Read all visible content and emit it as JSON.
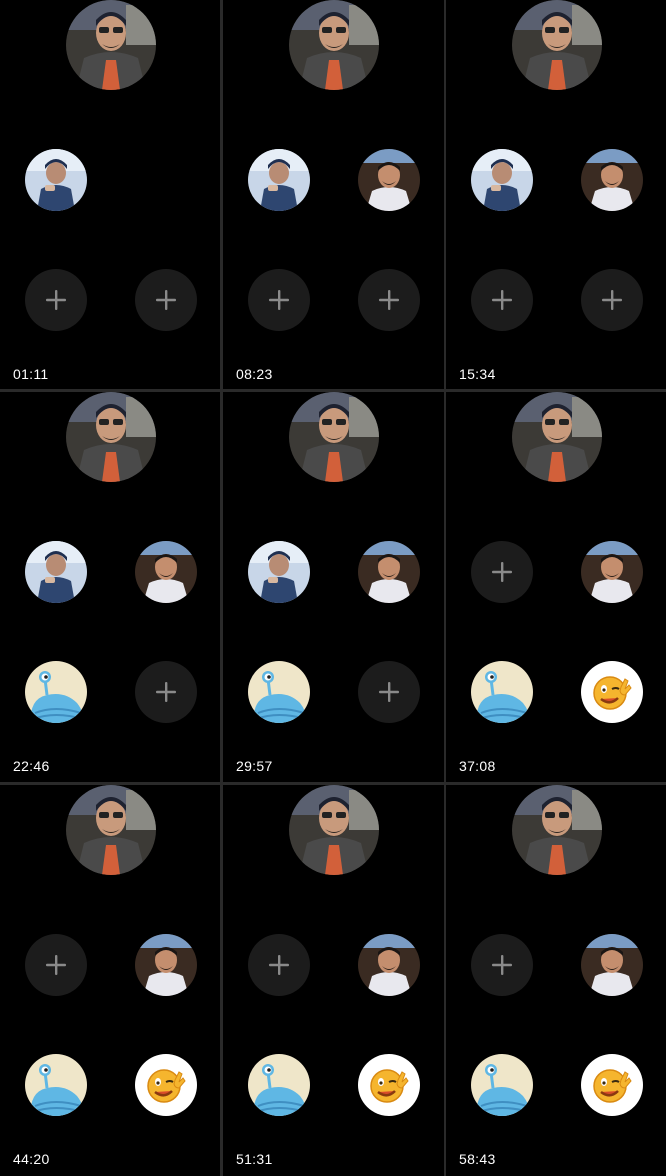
{
  "app": {
    "screen": "video call grid recording"
  },
  "panels": [
    {
      "time": "01:11",
      "slots": [
        "user1",
        "",
        "add",
        "add"
      ]
    },
    {
      "time": "08:23",
      "slots": [
        "user1",
        "user2",
        "add",
        "add"
      ]
    },
    {
      "time": "15:34",
      "slots": [
        "user1",
        "user2",
        "add",
        "add"
      ]
    },
    {
      "time": "22:46",
      "slots": [
        "user1",
        "user2",
        "user3",
        "add"
      ]
    },
    {
      "time": "29:57",
      "slots": [
        "user1",
        "user2",
        "user3",
        "add"
      ]
    },
    {
      "time": "37:08",
      "slots": [
        "add",
        "user2",
        "user3",
        "user4"
      ]
    },
    {
      "time": "44:20",
      "slots": [
        "add",
        "user2",
        "user3",
        "user4"
      ]
    },
    {
      "time": "51:31",
      "slots": [
        "add",
        "user2",
        "user3",
        "user4"
      ]
    },
    {
      "time": "58:43",
      "slots": [
        "add",
        "user2",
        "user3",
        "user4"
      ]
    }
  ],
  "icons": {
    "add": "plus-icon",
    "user1": "avatar-photo-blue-icon",
    "user2": "avatar-photo-man-icon",
    "user3": "avatar-cartoon-alien-icon",
    "user4": "avatar-emoji-wink-icon",
    "host": "avatar-photo-host-icon"
  },
  "colors": {
    "background": "#000000",
    "divider": "#2a2a2a",
    "add_button": "#1c1c1c",
    "plus": "#8a8a8a"
  }
}
